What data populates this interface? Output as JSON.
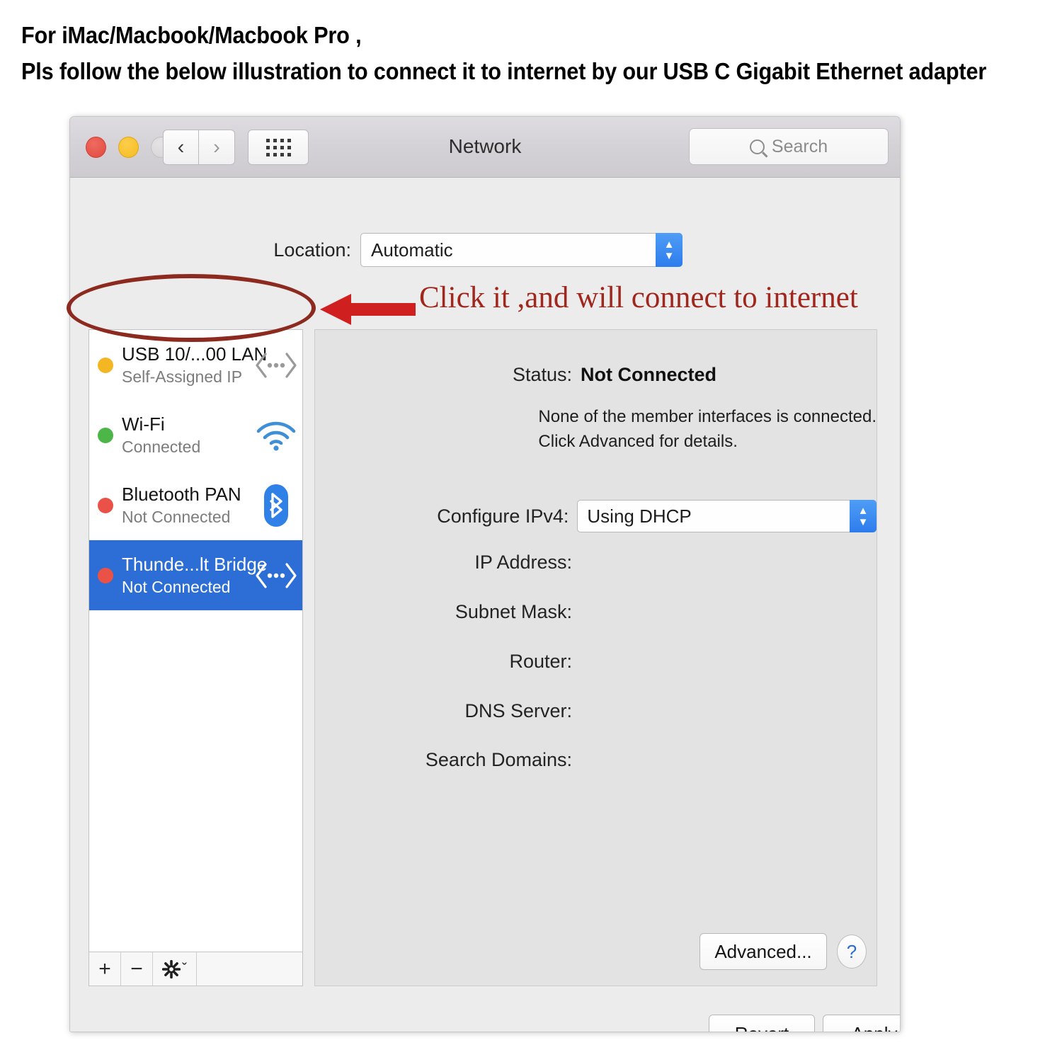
{
  "header": {
    "line1": "For iMac/Macbook/Macbook Pro ,",
    "line2": "Pls follow the below illustration to connect it to internet by our USB C Gigabit Ethernet adapter"
  },
  "window": {
    "title": "Network",
    "traffic_lights": [
      "close",
      "minimize",
      "zoom"
    ],
    "nav": {
      "back": "‹",
      "forward": "›"
    },
    "grid_button": "show-all-grid",
    "search": {
      "placeholder": "Search",
      "value": ""
    }
  },
  "location": {
    "label": "Location:",
    "value": "Automatic"
  },
  "sidebar": {
    "services": [
      {
        "name": "USB 10/...00 LAN",
        "status": "Self-Assigned IP",
        "dot": "orange",
        "icon": "ethernet-icon",
        "selected": false
      },
      {
        "name": "Wi-Fi",
        "status": "Connected",
        "dot": "green",
        "icon": "wifi-icon",
        "selected": false
      },
      {
        "name": "Bluetooth PAN",
        "status": "Not Connected",
        "dot": "red",
        "icon": "bluetooth-icon",
        "selected": false
      },
      {
        "name": "Thunde...lt Bridge",
        "status": "Not Connected",
        "dot": "red",
        "icon": "ethernet-icon",
        "selected": true
      }
    ],
    "toolbar": {
      "add": "+",
      "remove": "−",
      "gear": "⚙",
      "gear_chevron": "ˇ"
    }
  },
  "detail": {
    "status_label": "Status:",
    "status_value": "Not Connected",
    "note_line1": "None of the member interfaces is connected.",
    "note_line2": "Click Advanced for details.",
    "configure_ipv4_label": "Configure IPv4:",
    "configure_ipv4_value": "Using DHCP",
    "fields": [
      {
        "label": "IP Address:",
        "value": ""
      },
      {
        "label": "Subnet Mask:",
        "value": ""
      },
      {
        "label": "Router:",
        "value": ""
      },
      {
        "label": "DNS Server:",
        "value": ""
      },
      {
        "label": "Search Domains:",
        "value": ""
      }
    ],
    "advanced_button": "Advanced...",
    "help_button": "?"
  },
  "buttons": {
    "revert": "Revert",
    "apply": "Apply"
  },
  "annotation": {
    "text": "Click  it ,and will connect to internet",
    "color": "#a0271d",
    "oval_color": "#8c2a20",
    "arrow_color": "#cf1f1f"
  },
  "colors": {
    "selection_blue": "#2c6ed5",
    "stepper_blue": "#2d7ced",
    "status_orange": "#f5b624",
    "status_green": "#4cb648",
    "status_red": "#eb5247",
    "window_bg": "#ececec",
    "panel_bg": "#e3e3e3"
  }
}
